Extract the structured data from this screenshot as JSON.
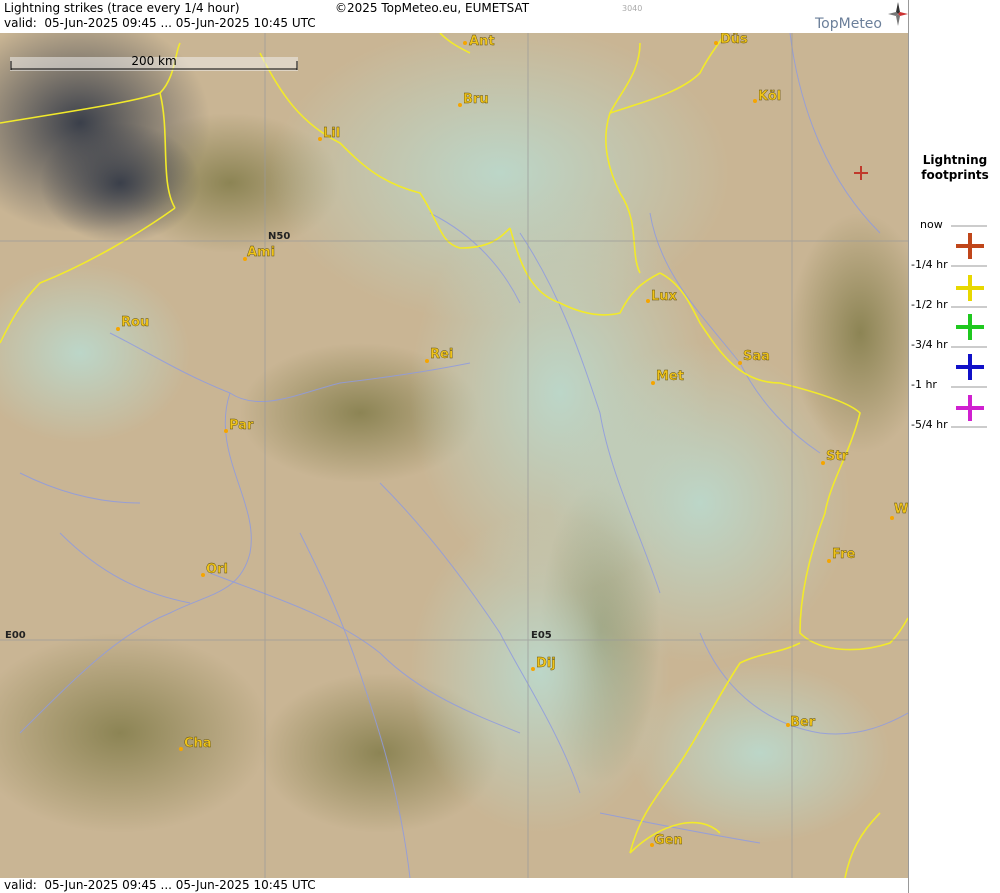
{
  "header": {
    "title": "Lightning strikes (trace every 1/4 hour)",
    "copyright": "©2025 TopMeteo.eu, EUMETSAT",
    "code": "3040",
    "valid": "valid:  05-Jun-2025 09:45 ... 05-Jun-2025 10:45 UTC",
    "logo": "TopMeteo"
  },
  "map": {
    "scale_label": "200 km",
    "grid_labels": {
      "n50": "N50",
      "e00": "E00",
      "e05": "E05"
    },
    "cities": [
      {
        "name": "Ant"
      },
      {
        "name": "Düs"
      },
      {
        "name": "Bru"
      },
      {
        "name": "Köl"
      },
      {
        "name": "Lil"
      },
      {
        "name": "Ami"
      },
      {
        "name": "Lux"
      },
      {
        "name": "Rou"
      },
      {
        "name": "Rei"
      },
      {
        "name": "Saa"
      },
      {
        "name": "Met"
      },
      {
        "name": "Par"
      },
      {
        "name": "Str"
      },
      {
        "name": "W"
      },
      {
        "name": "Fre"
      },
      {
        "name": "Orl"
      },
      {
        "name": "Dij"
      },
      {
        "name": "Ber"
      },
      {
        "name": "Cha"
      },
      {
        "name": "Gen"
      }
    ],
    "strikes": [
      {
        "age": "-1/4 hr",
        "color": "#c0392b"
      }
    ]
  },
  "footer": {
    "valid": "valid:  05-Jun-2025 09:45 ... 05-Jun-2025 10:45 UTC"
  },
  "legend": {
    "title_line1": "Lightning",
    "title_line2": "footprints",
    "entries": [
      {
        "time": "now",
        "color": "#c0461a"
      },
      {
        "time": "-1/4 hr",
        "color": "#e8d800"
      },
      {
        "time": "-1/2 hr",
        "color": "#1fc81f"
      },
      {
        "time": "-3/4 hr",
        "color": "#1010c8"
      },
      {
        "time": "-1 hr",
        "color": "#d020d0"
      },
      {
        "time": "-5/4 hr"
      }
    ]
  }
}
